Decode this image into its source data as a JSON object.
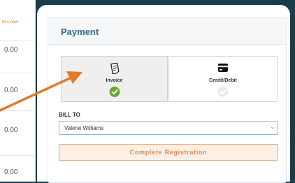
{
  "left_panel": {
    "link_text": "ters now",
    "prices": [
      "0.00",
      "0.00",
      "0.00",
      "0.00"
    ]
  },
  "payment": {
    "title": "Payment",
    "methods": [
      {
        "label": "Invoice",
        "icon": "invoice-icon",
        "selected": true
      },
      {
        "label": "Credit/Debit",
        "icon": "credit-card-icon",
        "selected": false
      }
    ],
    "bill_to_label": "BILL TO",
    "bill_to_value": "Valerie Williams",
    "complete_button": "Complete Registration"
  },
  "colors": {
    "background": "#1a3d4a",
    "accent_orange": "#e07b2a",
    "title_blue": "#2d6b9b",
    "check_green": "#6aa82d"
  }
}
